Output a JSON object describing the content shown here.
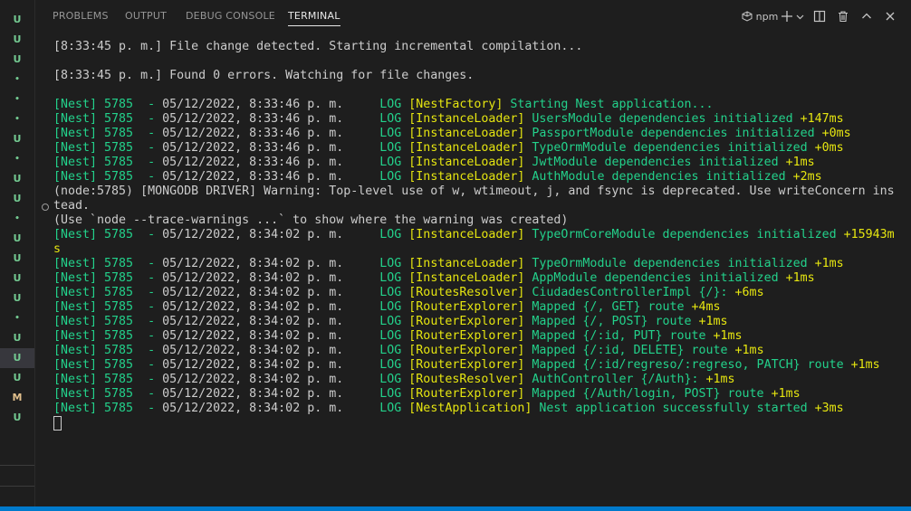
{
  "gutter": {
    "items": [
      "U",
      "U",
      "U",
      "•",
      "•",
      "•",
      "U",
      "•",
      "U",
      "U",
      "•",
      "U",
      "U",
      "U",
      "U",
      "•",
      "U",
      "U",
      "U",
      "M",
      "U"
    ]
  },
  "panel": {
    "tabs": [
      {
        "label": "PROBLEMS",
        "active": false
      },
      {
        "label": "OUTPUT",
        "active": false
      },
      {
        "label": "DEBUG CONSOLE",
        "active": false
      },
      {
        "label": "TERMINAL",
        "active": true
      }
    ],
    "terminal_name": "npm"
  },
  "terminal": {
    "lines": [
      [
        {
          "t": "[8:33:45 p. m.] File change detected. Starting incremental compilation...",
          "c": "w"
        }
      ],
      [],
      [
        {
          "t": "[8:33:45 p. m.] Found 0 errors. Watching for file changes.",
          "c": "w"
        }
      ],
      [],
      [
        {
          "t": "[Nest] 5785  - ",
          "c": "g"
        },
        {
          "t": "05/12/2022, 8:33:46 p. m.",
          "c": "w"
        },
        {
          "t": "     LOG ",
          "c": "g"
        },
        {
          "t": "[NestFactory] ",
          "c": "y"
        },
        {
          "t": "Starting Nest application...",
          "c": "g"
        }
      ],
      [
        {
          "t": "[Nest] 5785  - ",
          "c": "g"
        },
        {
          "t": "05/12/2022, 8:33:46 p. m.",
          "c": "w"
        },
        {
          "t": "     LOG ",
          "c": "g"
        },
        {
          "t": "[InstanceLoader] ",
          "c": "y"
        },
        {
          "t": "UsersModule dependencies initialized ",
          "c": "g"
        },
        {
          "t": "+147ms",
          "c": "y"
        }
      ],
      [
        {
          "t": "[Nest] 5785  - ",
          "c": "g"
        },
        {
          "t": "05/12/2022, 8:33:46 p. m.",
          "c": "w"
        },
        {
          "t": "     LOG ",
          "c": "g"
        },
        {
          "t": "[InstanceLoader] ",
          "c": "y"
        },
        {
          "t": "PassportModule dependencies initialized ",
          "c": "g"
        },
        {
          "t": "+0ms",
          "c": "y"
        }
      ],
      [
        {
          "t": "[Nest] 5785  - ",
          "c": "g"
        },
        {
          "t": "05/12/2022, 8:33:46 p. m.",
          "c": "w"
        },
        {
          "t": "     LOG ",
          "c": "g"
        },
        {
          "t": "[InstanceLoader] ",
          "c": "y"
        },
        {
          "t": "TypeOrmModule dependencies initialized ",
          "c": "g"
        },
        {
          "t": "+0ms",
          "c": "y"
        }
      ],
      [
        {
          "t": "[Nest] 5785  - ",
          "c": "g"
        },
        {
          "t": "05/12/2022, 8:33:46 p. m.",
          "c": "w"
        },
        {
          "t": "     LOG ",
          "c": "g"
        },
        {
          "t": "[InstanceLoader] ",
          "c": "y"
        },
        {
          "t": "JwtModule dependencies initialized ",
          "c": "g"
        },
        {
          "t": "+1ms",
          "c": "y"
        }
      ],
      [
        {
          "t": "[Nest] 5785  - ",
          "c": "g"
        },
        {
          "t": "05/12/2022, 8:33:46 p. m.",
          "c": "w"
        },
        {
          "t": "     LOG ",
          "c": "g"
        },
        {
          "t": "[InstanceLoader] ",
          "c": "y"
        },
        {
          "t": "AuthModule dependencies initialized ",
          "c": "g"
        },
        {
          "t": "+2ms",
          "c": "y"
        }
      ],
      [
        {
          "t": "(node:5785) [MONGODB DRIVER] Warning: Top-level use of w, wtimeout, j, and fsync is deprecated. Use writeConcern ins",
          "c": "w"
        }
      ],
      [
        {
          "t": "tead.",
          "c": "w"
        }
      ],
      [
        {
          "t": "(Use `node --trace-warnings ...` to show where the warning was created)",
          "c": "w"
        }
      ],
      [
        {
          "t": "[Nest] 5785  - ",
          "c": "g"
        },
        {
          "t": "05/12/2022, 8:34:02 p. m.",
          "c": "w"
        },
        {
          "t": "     LOG ",
          "c": "g"
        },
        {
          "t": "[InstanceLoader] ",
          "c": "y"
        },
        {
          "t": "TypeOrmCoreModule dependencies initialized ",
          "c": "g"
        },
        {
          "t": "+15943m",
          "c": "y"
        }
      ],
      [
        {
          "t": "s",
          "c": "y"
        }
      ],
      [
        {
          "t": "[Nest] 5785  - ",
          "c": "g"
        },
        {
          "t": "05/12/2022, 8:34:02 p. m.",
          "c": "w"
        },
        {
          "t": "     LOG ",
          "c": "g"
        },
        {
          "t": "[InstanceLoader] ",
          "c": "y"
        },
        {
          "t": "TypeOrmModule dependencies initialized ",
          "c": "g"
        },
        {
          "t": "+1ms",
          "c": "y"
        }
      ],
      [
        {
          "t": "[Nest] 5785  - ",
          "c": "g"
        },
        {
          "t": "05/12/2022, 8:34:02 p. m.",
          "c": "w"
        },
        {
          "t": "     LOG ",
          "c": "g"
        },
        {
          "t": "[InstanceLoader] ",
          "c": "y"
        },
        {
          "t": "AppModule dependencies initialized ",
          "c": "g"
        },
        {
          "t": "+1ms",
          "c": "y"
        }
      ],
      [
        {
          "t": "[Nest] 5785  - ",
          "c": "g"
        },
        {
          "t": "05/12/2022, 8:34:02 p. m.",
          "c": "w"
        },
        {
          "t": "     LOG ",
          "c": "g"
        },
        {
          "t": "[RoutesResolver] ",
          "c": "y"
        },
        {
          "t": "CiudadesControllerImpl {/}: ",
          "c": "g"
        },
        {
          "t": "+6ms",
          "c": "y"
        }
      ],
      [
        {
          "t": "[Nest] 5785  - ",
          "c": "g"
        },
        {
          "t": "05/12/2022, 8:34:02 p. m.",
          "c": "w"
        },
        {
          "t": "     LOG ",
          "c": "g"
        },
        {
          "t": "[RouterExplorer] ",
          "c": "y"
        },
        {
          "t": "Mapped {/, GET} route ",
          "c": "g"
        },
        {
          "t": "+4ms",
          "c": "y"
        }
      ],
      [
        {
          "t": "[Nest] 5785  - ",
          "c": "g"
        },
        {
          "t": "05/12/2022, 8:34:02 p. m.",
          "c": "w"
        },
        {
          "t": "     LOG ",
          "c": "g"
        },
        {
          "t": "[RouterExplorer] ",
          "c": "y"
        },
        {
          "t": "Mapped {/, POST} route ",
          "c": "g"
        },
        {
          "t": "+1ms",
          "c": "y"
        }
      ],
      [
        {
          "t": "[Nest] 5785  - ",
          "c": "g"
        },
        {
          "t": "05/12/2022, 8:34:02 p. m.",
          "c": "w"
        },
        {
          "t": "     LOG ",
          "c": "g"
        },
        {
          "t": "[RouterExplorer] ",
          "c": "y"
        },
        {
          "t": "Mapped {/:id, PUT} route ",
          "c": "g"
        },
        {
          "t": "+1ms",
          "c": "y"
        }
      ],
      [
        {
          "t": "[Nest] 5785  - ",
          "c": "g"
        },
        {
          "t": "05/12/2022, 8:34:02 p. m.",
          "c": "w"
        },
        {
          "t": "     LOG ",
          "c": "g"
        },
        {
          "t": "[RouterExplorer] ",
          "c": "y"
        },
        {
          "t": "Mapped {/:id, DELETE} route ",
          "c": "g"
        },
        {
          "t": "+1ms",
          "c": "y"
        }
      ],
      [
        {
          "t": "[Nest] 5785  - ",
          "c": "g"
        },
        {
          "t": "05/12/2022, 8:34:02 p. m.",
          "c": "w"
        },
        {
          "t": "     LOG ",
          "c": "g"
        },
        {
          "t": "[RouterExplorer] ",
          "c": "y"
        },
        {
          "t": "Mapped {/:id/regreso/:regreso, PATCH} route ",
          "c": "g"
        },
        {
          "t": "+1ms",
          "c": "y"
        }
      ],
      [
        {
          "t": "[Nest] 5785  - ",
          "c": "g"
        },
        {
          "t": "05/12/2022, 8:34:02 p. m.",
          "c": "w"
        },
        {
          "t": "     LOG ",
          "c": "g"
        },
        {
          "t": "[RoutesResolver] ",
          "c": "y"
        },
        {
          "t": "AuthController {/Auth}: ",
          "c": "g"
        },
        {
          "t": "+1ms",
          "c": "y"
        }
      ],
      [
        {
          "t": "[Nest] 5785  - ",
          "c": "g"
        },
        {
          "t": "05/12/2022, 8:34:02 p. m.",
          "c": "w"
        },
        {
          "t": "     LOG ",
          "c": "g"
        },
        {
          "t": "[RouterExplorer] ",
          "c": "y"
        },
        {
          "t": "Mapped {/Auth/login, POST} route ",
          "c": "g"
        },
        {
          "t": "+1ms",
          "c": "y"
        }
      ],
      [
        {
          "t": "[Nest] 5785  - ",
          "c": "g"
        },
        {
          "t": "05/12/2022, 8:34:02 p. m.",
          "c": "w"
        },
        {
          "t": "     LOG ",
          "c": "g"
        },
        {
          "t": "[NestApplication] ",
          "c": "y"
        },
        {
          "t": "Nest application successfully started ",
          "c": "g"
        },
        {
          "t": "+3ms",
          "c": "y"
        }
      ]
    ]
  },
  "colors": {
    "green": "#23d18b",
    "yellow": "#e5e510",
    "text": "#cccccc",
    "accent": "#007acc"
  }
}
